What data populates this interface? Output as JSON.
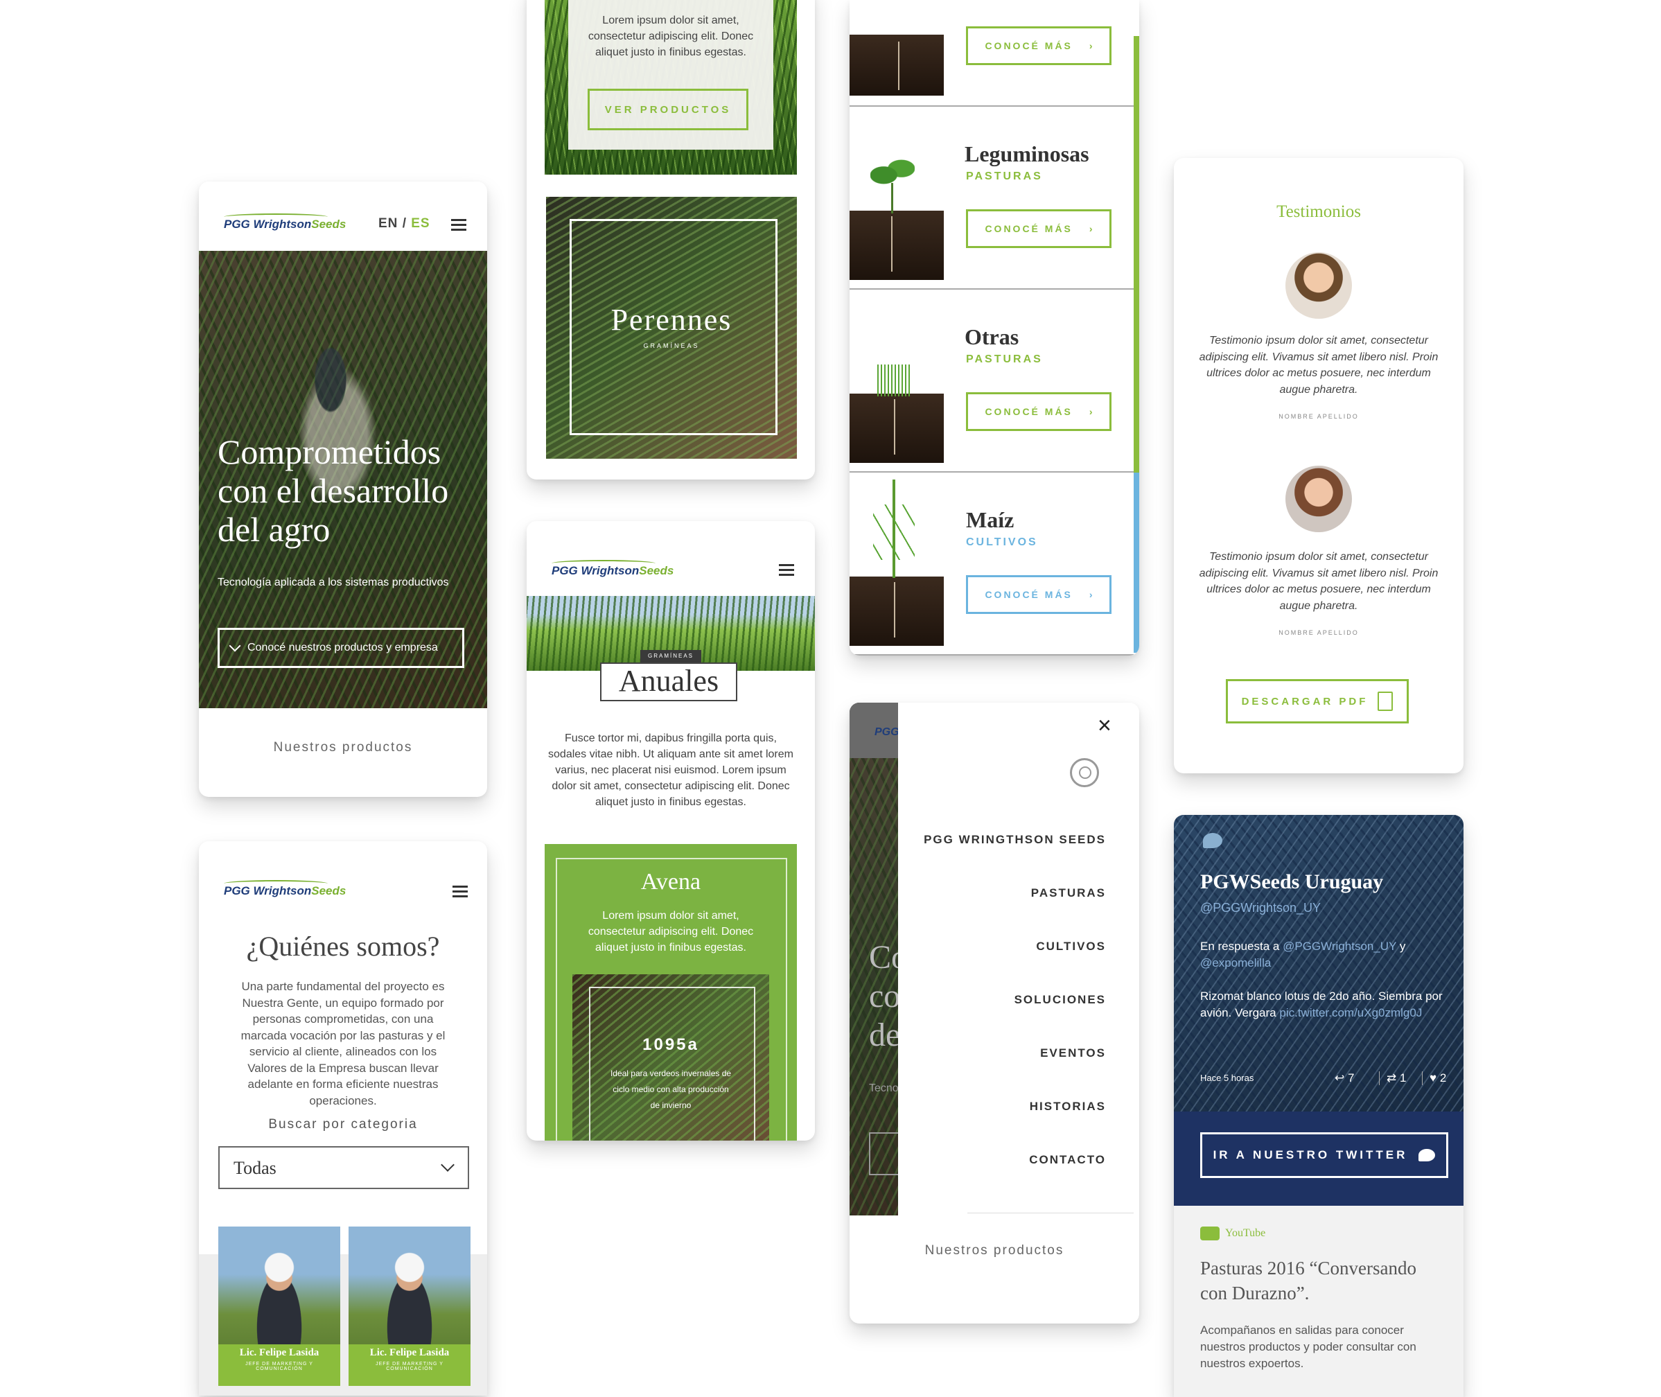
{
  "brand": {
    "logo_main": "PGG Wrightson",
    "logo_suffix": "Seeds",
    "green": "#8bbd3c",
    "navy": "#1f3d7a"
  },
  "home": {
    "lang_en": "EN",
    "lang_sep": "/",
    "lang_es": "ES",
    "hero_title": "Comprometidos con el desarrollo del agro",
    "hero_subtitle": "Tecnología aplicada a los sistemas productivos",
    "hero_button": "Conocé nuestros productos y empresa",
    "section_label": "Nuestros productos"
  },
  "about": {
    "title": "¿Quiénes somos?",
    "body": "Una parte fundamental del proyecto es Nuestra Gente, un equipo formado por personas comprometidas, con una marcada vocación por las pasturas y el servicio al cliente, alineados con los Valores de la Empresa buscan llevar adelante en forma eficiente nuestras operaciones.",
    "filter_label": "Buscar por categoria",
    "select_value": "Todas",
    "people": [
      {
        "name": "Lic. Felipe Lasida",
        "role": "JEFE DE MARKETING Y COMUNICACIÓN"
      },
      {
        "name": "Lic. Felipe Lasida",
        "role": "JEFE DE MARKETING Y COMUNICACIÓN"
      }
    ]
  },
  "products_top": {
    "intro": "Lorem ipsum dolor sit amet, consectetur adipiscing elit. Donec aliquet justo in finibus egestas.",
    "button": "VER PRODUCTOS",
    "perennes_title": "Perennes",
    "perennes_sub": "GRAMÍNEAS"
  },
  "anuales": {
    "badge": "GRAMÍNEAS",
    "title": "Anuales",
    "body": "Fusce tortor mi, dapibus fringilla porta quis, sodales vitae nibh. Ut aliquam ante sit amet lorem varius, nec placerat nisi euismod. Lorem ipsum dolor sit amet, consectetur adipiscing elit. Donec aliquet justo in finibus egestas.",
    "product_title": "Avena",
    "product_body": "Lorem ipsum dolor sit amet, consectetur adipiscing elit. Donec aliquet justo in finibus egestas.",
    "variety_code": "1095a",
    "variety_desc": "Ideal para verdeos invernales de ciclo medio con alta producción de invierno"
  },
  "categories": {
    "button": "CONOCÉ MÁS",
    "items": [
      {
        "title": "Leguminosas",
        "tag": "PASTURAS",
        "color": "#8bbd3c"
      },
      {
        "title": "Otras",
        "tag": "PASTURAS",
        "color": "#8bbd3c"
      },
      {
        "title": "Maíz",
        "tag": "CULTIVOS",
        "color": "#6bb4df"
      }
    ]
  },
  "menu": {
    "close": "×",
    "items": [
      "PGG WRINGTHSON SEEDS",
      "PASTURAS",
      "CULTIVOS",
      "SOLUCIONES",
      "EVENTOS",
      "HISTORIAS",
      "CONTACTO"
    ],
    "footer": "Nuestros productos",
    "bg_partial_logo": "PGG",
    "bg_partial_title_1": "Co",
    "bg_partial_title_2": "co",
    "bg_partial_title_3": "de",
    "bg_partial_sub": "Tecno"
  },
  "testimonials": {
    "title": "Testimonios",
    "items": [
      {
        "text": "Testimonio ipsum dolor sit amet, consectetur adipiscing elit. Vivamus sit amet libero nisl. Proin ultrices dolor ac metus posuere, nec interdum augue pharetra.",
        "author": "NOMBRE APELLIDO"
      },
      {
        "text": "Testimonio ipsum dolor sit amet, consectetur adipiscing elit. Vivamus sit amet libero nisl. Proin ultrices dolor ac metus posuere, nec interdum augue pharetra.",
        "author": "NOMBRE APELLIDO"
      }
    ],
    "button": "DESCARGAR PDF"
  },
  "twitter": {
    "name": "PGWSeeds Uruguay",
    "handle": "@PGGWrightson_UY",
    "reply_prefix": "En respuesta a",
    "reply_to_1": "@PGGWrightson_UY",
    "reply_and": "y",
    "reply_to_2": "@expomelilla",
    "tweet": "Rizomat blanco lotus de 2do año. Siembra por avión. Vergara",
    "tweet_link": "pic.twitter.com/uXg0zmlg0J",
    "time": "Hace 5 horas",
    "replies": "7",
    "retweets": "1",
    "likes": "2",
    "button": "IR A NUESTRO TWITTER",
    "accent": "#1e3263"
  },
  "youtube": {
    "label": "YouTube",
    "title": "Pasturas 2016 “Conversando con Durazno”.",
    "body": "Acompañanos en salidas para conocer nuestros productos y poder consultar con nuestros expoertos."
  }
}
